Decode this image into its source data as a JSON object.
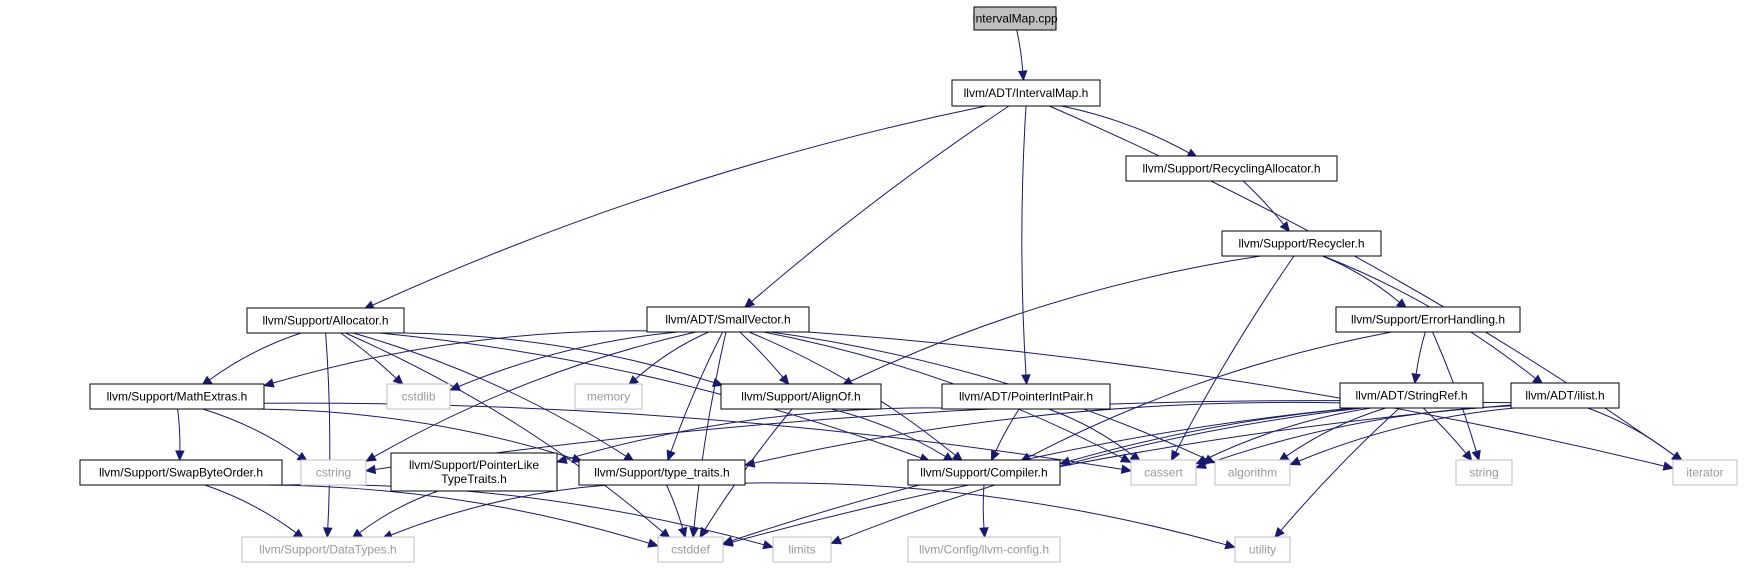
{
  "nodes": [
    {
      "id": "root",
      "label": "IntervalMap.cpp",
      "kind": "root"
    },
    {
      "id": "imap",
      "label": "llvm/ADT/IntervalMap.h",
      "kind": "internal"
    },
    {
      "id": "recalloc",
      "label": "llvm/Support/RecyclingAllocator.h",
      "kind": "internal"
    },
    {
      "id": "recycler",
      "label": "llvm/Support/Recycler.h",
      "kind": "internal"
    },
    {
      "id": "allocator",
      "label": "llvm/Support/Allocator.h",
      "kind": "internal"
    },
    {
      "id": "smallvec",
      "label": "llvm/ADT/SmallVector.h",
      "kind": "internal"
    },
    {
      "id": "errh",
      "label": "llvm/Support/ErrorHandling.h",
      "kind": "internal"
    },
    {
      "id": "mathx",
      "label": "llvm/Support/MathExtras.h",
      "kind": "internal"
    },
    {
      "id": "cstdlib",
      "label": "cstdlib",
      "kind": "external"
    },
    {
      "id": "memory",
      "label": "memory",
      "kind": "external"
    },
    {
      "id": "alignof",
      "label": "llvm/Support/AlignOf.h",
      "kind": "internal"
    },
    {
      "id": "pip",
      "label": "llvm/ADT/PointerIntPair.h",
      "kind": "internal"
    },
    {
      "id": "sref",
      "label": "llvm/ADT/StringRef.h",
      "kind": "internal"
    },
    {
      "id": "ilist",
      "label": "llvm/ADT/ilist.h",
      "kind": "internal"
    },
    {
      "id": "swap",
      "label": "llvm/Support/SwapByteOrder.h",
      "kind": "internal"
    },
    {
      "id": "cstring",
      "label": "cstring",
      "kind": "external"
    },
    {
      "id": "plt",
      "label": [
        "llvm/Support/PointerLike",
        "TypeTraits.h"
      ],
      "kind": "internal"
    },
    {
      "id": "tt",
      "label": "llvm/Support/type_traits.h",
      "kind": "internal"
    },
    {
      "id": "compiler",
      "label": "llvm/Support/Compiler.h",
      "kind": "internal"
    },
    {
      "id": "cassert",
      "label": "cassert",
      "kind": "external"
    },
    {
      "id": "algorithm",
      "label": "algorithm",
      "kind": "external"
    },
    {
      "id": "string",
      "label": "string",
      "kind": "external"
    },
    {
      "id": "iterator",
      "label": "iterator",
      "kind": "external"
    },
    {
      "id": "datatypes",
      "label": "llvm/Support/DataTypes.h",
      "kind": "external"
    },
    {
      "id": "cstddef",
      "label": "cstddef",
      "kind": "external"
    },
    {
      "id": "limits",
      "label": "limits",
      "kind": "external"
    },
    {
      "id": "config",
      "label": "llvm/Config/llvm-config.h",
      "kind": "external"
    },
    {
      "id": "utility",
      "label": "utility",
      "kind": "external"
    }
  ],
  "edges": [
    [
      "root",
      "imap"
    ],
    [
      "imap",
      "recalloc"
    ],
    [
      "imap",
      "allocator"
    ],
    [
      "imap",
      "smallvec"
    ],
    [
      "imap",
      "pip"
    ],
    [
      "imap",
      "iterator"
    ],
    [
      "recalloc",
      "recycler"
    ],
    [
      "recycler",
      "errh"
    ],
    [
      "recycler",
      "ilist"
    ],
    [
      "recycler",
      "alignof"
    ],
    [
      "recycler",
      "cassert"
    ],
    [
      "allocator",
      "mathx"
    ],
    [
      "allocator",
      "cstdlib"
    ],
    [
      "allocator",
      "alignof"
    ],
    [
      "allocator",
      "tt"
    ],
    [
      "allocator",
      "compiler"
    ],
    [
      "allocator",
      "datatypes"
    ],
    [
      "allocator",
      "cstddef"
    ],
    [
      "smallvec",
      "mathx"
    ],
    [
      "smallvec",
      "cstdlib"
    ],
    [
      "smallvec",
      "memory"
    ],
    [
      "smallvec",
      "alignof"
    ],
    [
      "smallvec",
      "cstring"
    ],
    [
      "smallvec",
      "tt"
    ],
    [
      "smallvec",
      "compiler"
    ],
    [
      "smallvec",
      "cassert"
    ],
    [
      "smallvec",
      "algorithm"
    ],
    [
      "smallvec",
      "iterator"
    ],
    [
      "smallvec",
      "cstddef"
    ],
    [
      "errh",
      "sref"
    ],
    [
      "errh",
      "compiler"
    ],
    [
      "errh",
      "string"
    ],
    [
      "mathx",
      "swap"
    ],
    [
      "mathx",
      "cstring"
    ],
    [
      "mathx",
      "tt"
    ],
    [
      "mathx",
      "cassert"
    ],
    [
      "alignof",
      "compiler"
    ],
    [
      "alignof",
      "cstddef"
    ],
    [
      "pip",
      "plt"
    ],
    [
      "pip",
      "compiler"
    ],
    [
      "pip",
      "cassert"
    ],
    [
      "sref",
      "cstring"
    ],
    [
      "sref",
      "tt"
    ],
    [
      "sref",
      "cassert"
    ],
    [
      "sref",
      "algorithm"
    ],
    [
      "sref",
      "string"
    ],
    [
      "sref",
      "utility"
    ],
    [
      "sref",
      "limits"
    ],
    [
      "sref",
      "cstddef"
    ],
    [
      "ilist",
      "compiler"
    ],
    [
      "ilist",
      "cassert"
    ],
    [
      "ilist",
      "algorithm"
    ],
    [
      "ilist",
      "iterator"
    ],
    [
      "ilist",
      "cstddef"
    ],
    [
      "swap",
      "datatypes"
    ],
    [
      "swap",
      "cstddef"
    ],
    [
      "swap",
      "limits"
    ],
    [
      "plt",
      "datatypes"
    ],
    [
      "tt",
      "datatypes"
    ],
    [
      "tt",
      "cstddef"
    ],
    [
      "tt",
      "utility"
    ],
    [
      "compiler",
      "config"
    ]
  ]
}
